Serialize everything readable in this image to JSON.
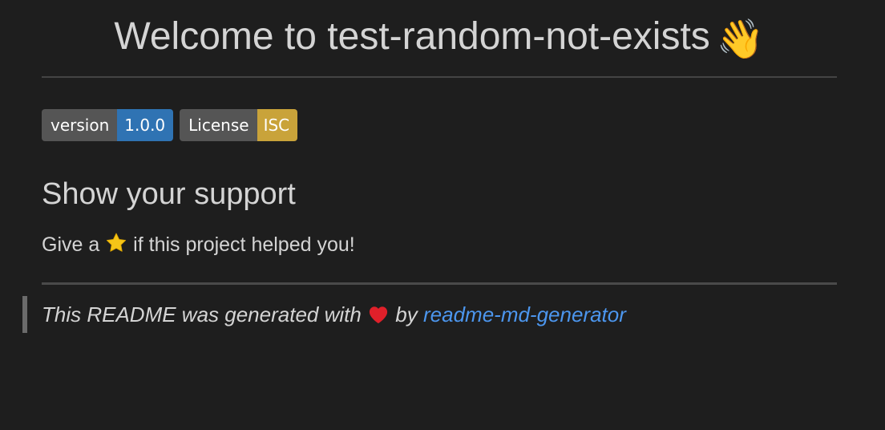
{
  "header": {
    "title": "Welcome to test-random-not-exists",
    "title_emoji": "👋"
  },
  "badges": [
    {
      "label": "version",
      "value": "1.0.0",
      "color": "#2f73b3",
      "icon": ""
    },
    {
      "label": "License",
      "value": "ISC",
      "color": "#c9a33a",
      "icon": ""
    }
  ],
  "support": {
    "heading": "Show your support",
    "text_before": "Give a",
    "text_after": "if this project helped you!",
    "icon": "star-icon"
  },
  "footer": {
    "text_before": "This README was generated with",
    "text_middle": "by",
    "link_text": "readme-md-generator",
    "icon": "heart-icon",
    "link_color": "#4c96ee"
  }
}
